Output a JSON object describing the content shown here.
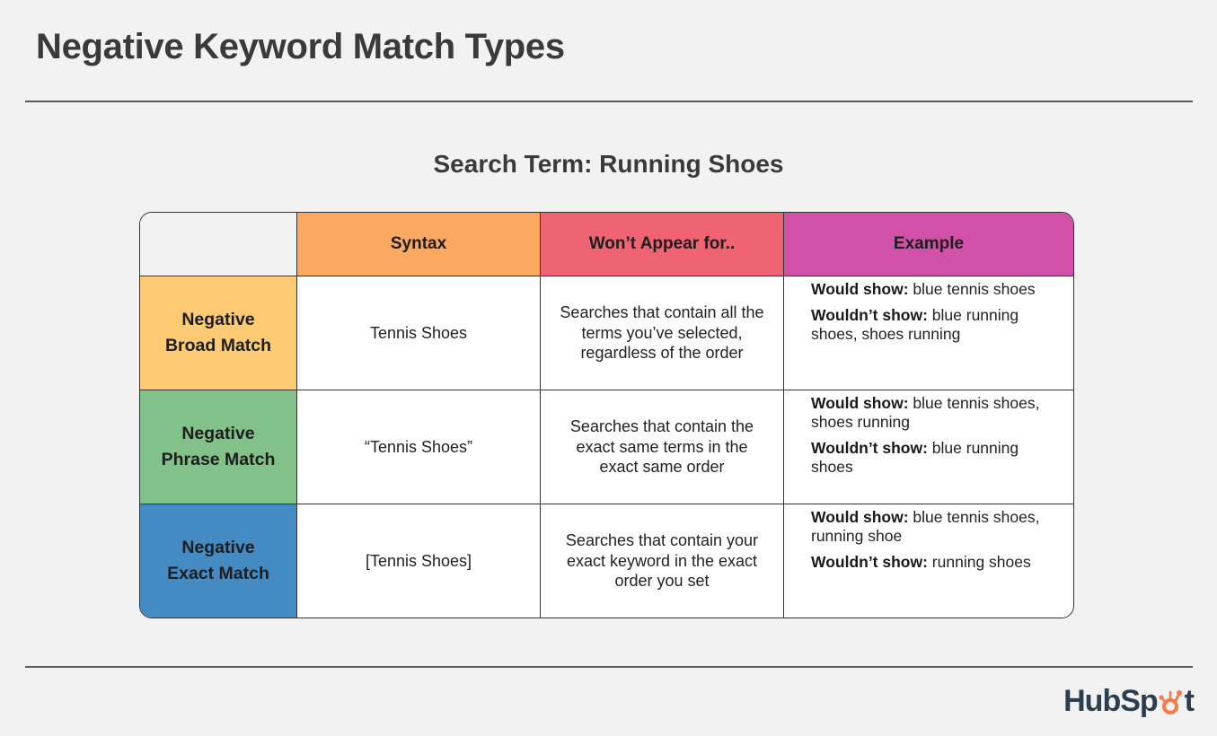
{
  "title": "Negative Keyword Match Types",
  "subtitle": "Search Term: Running Shoes",
  "table": {
    "headers": {
      "corner": "",
      "syntax": "Syntax",
      "wont_appear": "Won’t Appear for..",
      "example": "Example"
    },
    "colors": {
      "syntax_header": "#fba862",
      "wont_header": "#ef6373",
      "example_header": "#d151a9",
      "broad_row": "#fecb74",
      "phrase_row": "#82c18a",
      "exact_row": "#448bc4"
    },
    "rows": [
      {
        "label_line1": "Negative",
        "label_line2": "Broad Match",
        "syntax": "Tennis Shoes",
        "wont_appear": "Searches that contain all the terms you’ve selected, regardless of the order",
        "would_show_label": "Would show:",
        "would_show": " blue tennis shoes",
        "wouldnt_show_label": "Wouldn’t show:",
        "wouldnt_show": " blue running shoes, shoes running"
      },
      {
        "label_line1": "Negative",
        "label_line2": "Phrase Match",
        "syntax": "“Tennis Shoes”",
        "wont_appear": "Searches that contain the exact same terms in the exact same order",
        "would_show_label": "Would show:",
        "would_show": " blue tennis shoes, shoes running",
        "wouldnt_show_label": "Wouldn’t show:",
        "wouldnt_show": " blue running shoes"
      },
      {
        "label_line1": "Negative",
        "label_line2": "Exact Match",
        "syntax": "[Tennis Shoes]",
        "wont_appear": "Searches that contain your exact keyword in the exact order you set",
        "would_show_label": "Would show:",
        "would_show": " blue tennis shoes, running shoe",
        "wouldnt_show_label": "Wouldn’t show:",
        "wouldnt_show": " running shoes"
      }
    ]
  },
  "logo": {
    "text_before": "HubSp",
    "text_after": "t",
    "icon": "sprocket-icon",
    "primary_color": "#2d3e50",
    "accent_color": "#f57b48"
  }
}
